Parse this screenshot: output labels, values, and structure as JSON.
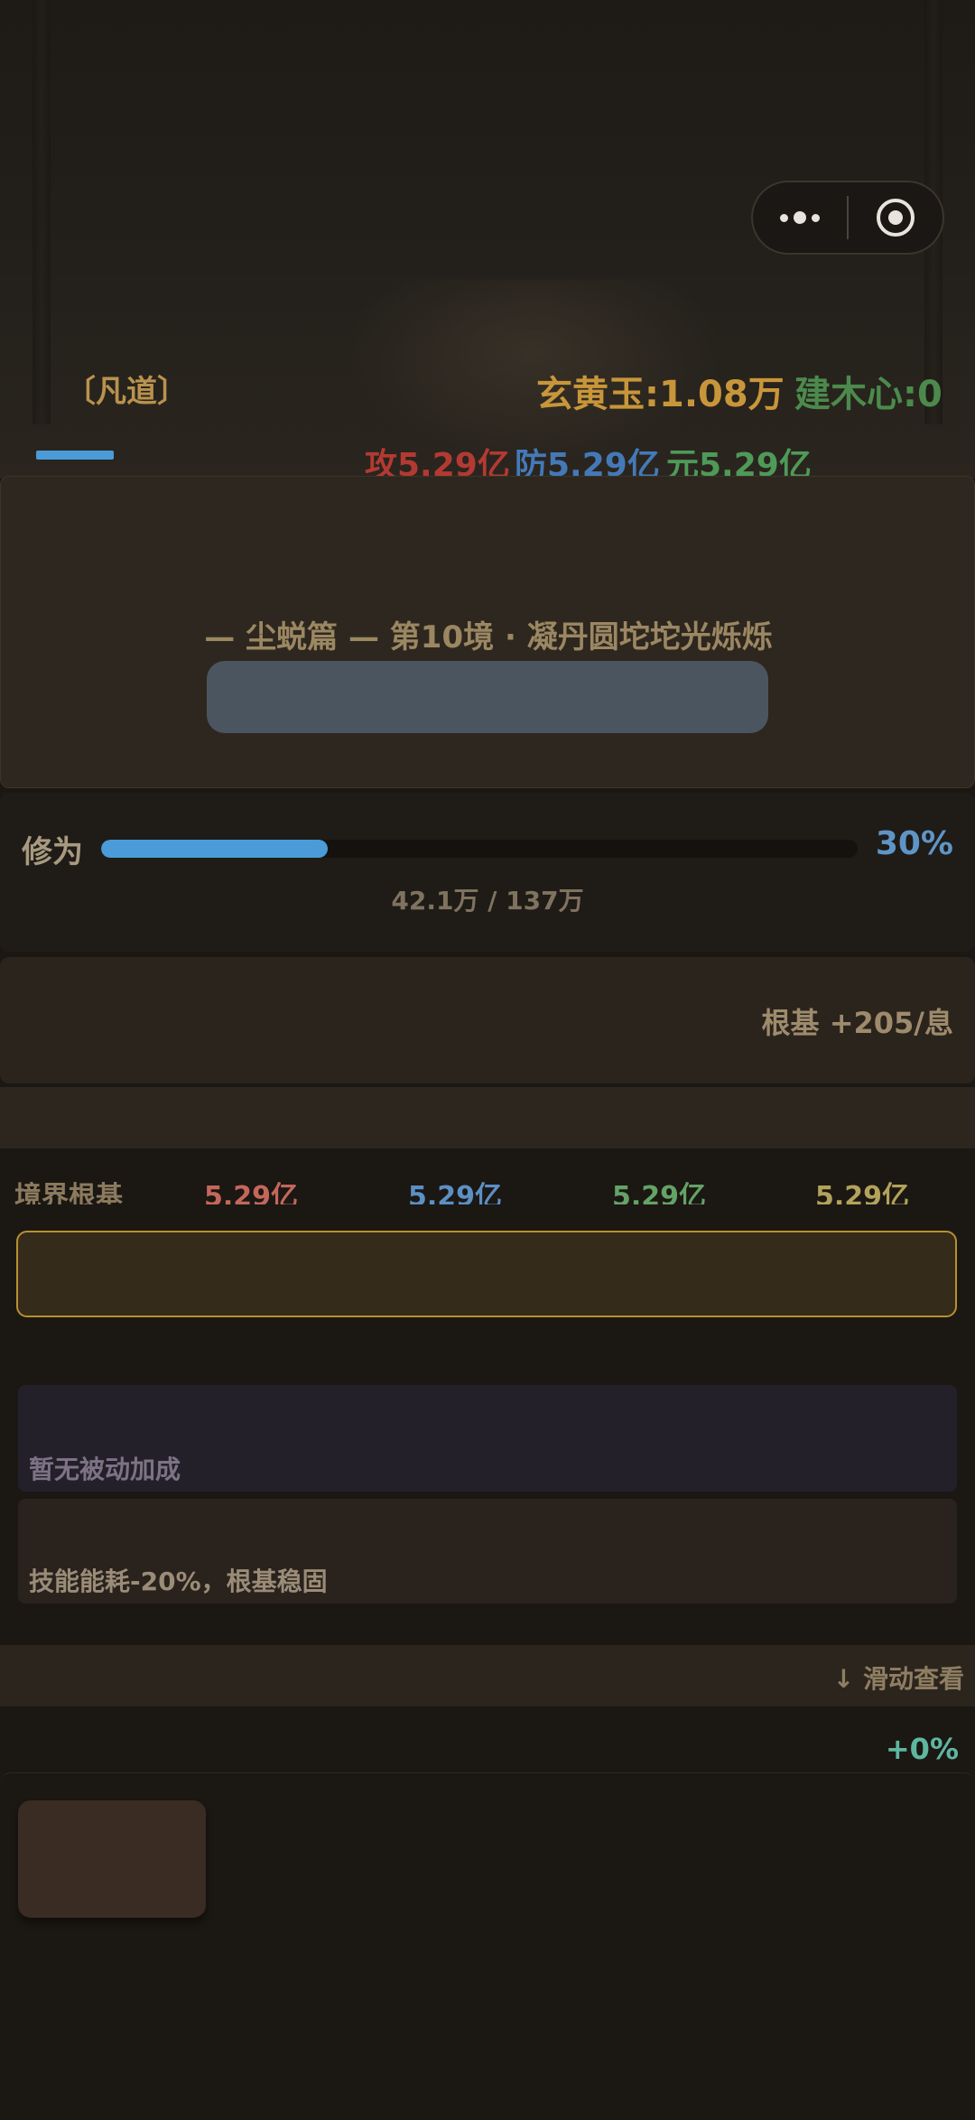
{
  "header": {
    "realm_tag": "〔凡道〕",
    "currency_jade": "玄黄玉:1.08万",
    "currency_wood": "建木心:0"
  },
  "stats": {
    "attack": "攻5.29亿",
    "defense": "防5.29亿",
    "yuan": "元5.29亿"
  },
  "realm": {
    "title": "— 尘蜕篇 —  第10境 · 凝丹圆坨坨光烁烁"
  },
  "cultivation": {
    "label": "修为",
    "progress_fraction": 0.3,
    "percent_text": "30%",
    "count_text": "42.1万 / 137万"
  },
  "foundation": {
    "rate_text": "根基 +205/息",
    "row_label": "境界根基",
    "values": [
      "5.29亿",
      "5.29亿",
      "5.29亿",
      "5.29亿"
    ]
  },
  "passive": {
    "empty_text": "暂无被动加成"
  },
  "skill": {
    "effect_text": "技能能耗-20%，根基稳固"
  },
  "scroll": {
    "hint_text": "↓ 滑动查看",
    "percent_badge": "+0%"
  },
  "colors": {
    "accent_blue": "#4a9bd8",
    "gold_border": "#b8902f",
    "attack_red": "#b33a33",
    "defense_blue": "#4479b8",
    "yuan_green": "#4e9a58"
  }
}
